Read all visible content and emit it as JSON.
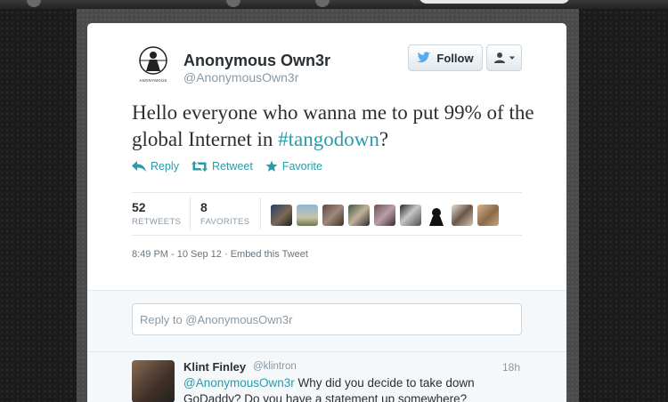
{
  "tweet": {
    "author_name": "Anonymous Own3r",
    "author_handle": "@AnonymousOwn3r",
    "avatar_caption": "ANONYMOUS",
    "follow_label": "Follow",
    "text_before": "Hello everyone who wanna me to put 99% of the global Internet in ",
    "hashtag": "#tangodown",
    "text_after": "?",
    "actions": {
      "reply": "Reply",
      "retweet": "Retweet",
      "favorite": "Favorite"
    },
    "stats": {
      "retweets_count": "52",
      "retweets_label": "RETWEETS",
      "favorites_count": "8",
      "favorites_label": "FAVORITES"
    },
    "timestamp": "8:49 PM - 10 Sep 12",
    "embed_link": "Embed this Tweet"
  },
  "reply_box": {
    "placeholder": "Reply to @AnonymousOwn3r"
  },
  "reply": {
    "name": "Klint Finley",
    "handle": "@klintron",
    "time": "18h",
    "mention": "@AnonymousOwn3r",
    "text": " Why did you decide to take down GoDaddy? Do you have a statement up somewhere?"
  },
  "colors": {
    "accent": "#2a9ba8",
    "twitter_blue": "#55acee",
    "muted": "#8899a6",
    "text": "#292f33"
  }
}
